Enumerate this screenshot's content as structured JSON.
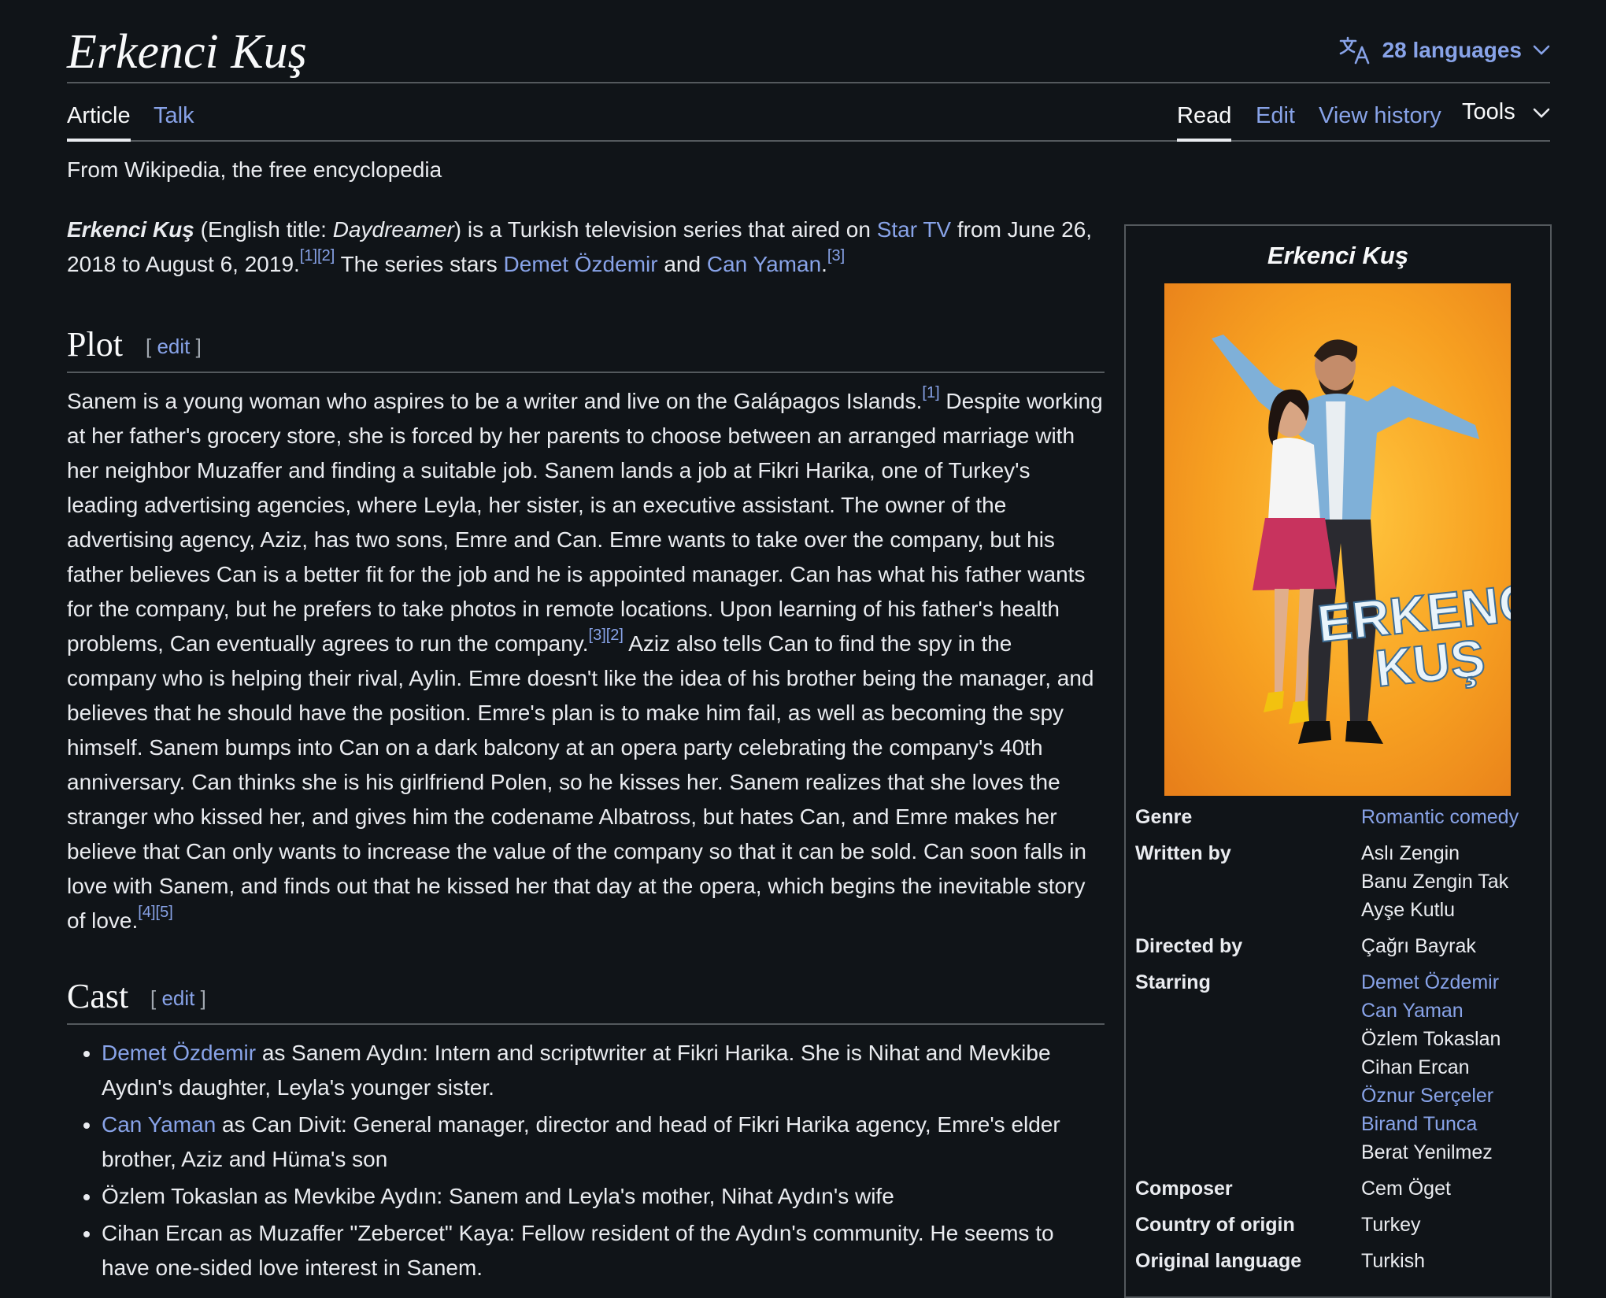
{
  "title": "Erkenci Kuş",
  "languages_label": "28 languages",
  "tabs_left": [
    "Article",
    "Talk"
  ],
  "tabs_right": [
    "Read",
    "Edit",
    "View history",
    "Tools"
  ],
  "tagline": "From Wikipedia, the free encyclopedia",
  "intro": {
    "bold_title": "Erkenci Kuş",
    "t1": " (English title: ",
    "english_title": "Daydreamer",
    "t2": ") is a Turkish television series that aired on ",
    "link_star_tv": "Star TV",
    "t3": " from June 26, 2018 to August 6, 2019.",
    "ref_a": "[1][2]",
    "t4": " The series stars ",
    "link_demet": "Demet Özdemir",
    "t5": " and ",
    "link_can": "Can Yaman",
    "t6": ".",
    "ref_b": "[3]"
  },
  "sections": {
    "plot_heading": "Plot",
    "cast_heading": "Cast",
    "edit_label": "edit",
    "bracket_open": "[ ",
    "bracket_close": " ]"
  },
  "plot": {
    "p1": "Sanem is a young woman who aspires to be a writer and live on the Galápagos Islands.",
    "ref1": "[1]",
    "p2": " Despite working at her father's grocery store, she is forced by her parents to choose between an arranged marriage with her neighbor Muzaffer and finding a suitable job. Sanem lands a job at Fikri Harika, one of Turkey's leading advertising agencies, where Leyla, her sister, is an executive assistant. The owner of the advertising agency, Aziz, has two sons, Emre and Can. Emre wants to take over the company, but his father believes Can is a better fit for the job and he is appointed manager. Can has what his father wants for the company, but he prefers to take photos in remote locations. Upon learning of his father's health problems, Can eventually agrees to run the company.",
    "ref2": "[3][2]",
    "p3": " Aziz also tells Can to find the spy in the company who is helping their rival, Aylin. Emre doesn't like the idea of his brother being the manager, and believes that he should have the position. Emre's plan is to make him fail, as well as becoming the spy himself. Sanem bumps into Can on a dark balcony at an opera party celebrating the company's 40th anniversary. Can thinks she is his girlfriend Polen, so he kisses her. Sanem realizes that she loves the stranger who kissed her, and gives him the codename Albatross, but hates Can, and Emre makes her believe that Can only wants to increase the value of the company so that it can be sold. Can soon falls in love with Sanem, and finds out that he kissed her that day at the opera, which begins the inevitable story of love.",
    "ref3": "[4][5]"
  },
  "cast": [
    {
      "link": "Demet Özdemir",
      "text": " as Sanem Aydın: Intern and scriptwriter at Fikri Harika. She is Nihat and Mevkibe Aydın's daughter, Leyla's younger sister."
    },
    {
      "link": "Can Yaman",
      "text": " as Can Divit: General manager, director and head of Fikri Harika agency, Emre's elder brother, Aziz and Hüma's son"
    },
    {
      "link": "",
      "text": "Özlem Tokaslan as Mevkibe Aydın: Sanem and Leyla's mother, Nihat Aydın's wife"
    },
    {
      "link": "",
      "text": "Cihan Ercan as Muzaffer \"Zebercet\" Kaya: Fellow resident of the Aydın's community. He seems to have one-sided love interest in Sanem."
    }
  ],
  "infobox": {
    "title": "Erkenci Kuş",
    "poster_text_line1": "ERKENCI",
    "poster_text_line2": "KUŞ",
    "rows": [
      {
        "label": "Genre",
        "values": [
          {
            "text": "Romantic comedy",
            "link": true
          }
        ]
      },
      {
        "label": "Written by",
        "values": [
          {
            "text": "Aslı Zengin",
            "link": false
          },
          {
            "text": "Banu Zengin Tak",
            "link": false
          },
          {
            "text": "Ayşe Kutlu",
            "link": false
          }
        ]
      },
      {
        "label": "Directed by",
        "values": [
          {
            "text": "Çağrı Bayrak",
            "link": false
          }
        ]
      },
      {
        "label": "Starring",
        "values": [
          {
            "text": "Demet Özdemir",
            "link": true
          },
          {
            "text": "Can Yaman",
            "link": true
          },
          {
            "text": "Özlem Tokaslan",
            "link": false
          },
          {
            "text": "Cihan Ercan",
            "link": false
          },
          {
            "text": "Öznur Serçeler",
            "link": true
          },
          {
            "text": "Birand Tunca",
            "link": true
          },
          {
            "text": "Berat Yenilmez",
            "link": false
          }
        ]
      },
      {
        "label": "Composer",
        "values": [
          {
            "text": "Cem Öget",
            "link": false
          }
        ]
      },
      {
        "label": "Country of origin",
        "values": [
          {
            "text": "Turkey",
            "link": false
          }
        ]
      },
      {
        "label": "Original language",
        "values": [
          {
            "text": "Turkish",
            "link": false
          }
        ]
      }
    ]
  },
  "colors": {
    "background": "#101418",
    "link": "#88a3e8",
    "text": "#eaecf0",
    "poster_orange": "#f39a1e"
  }
}
